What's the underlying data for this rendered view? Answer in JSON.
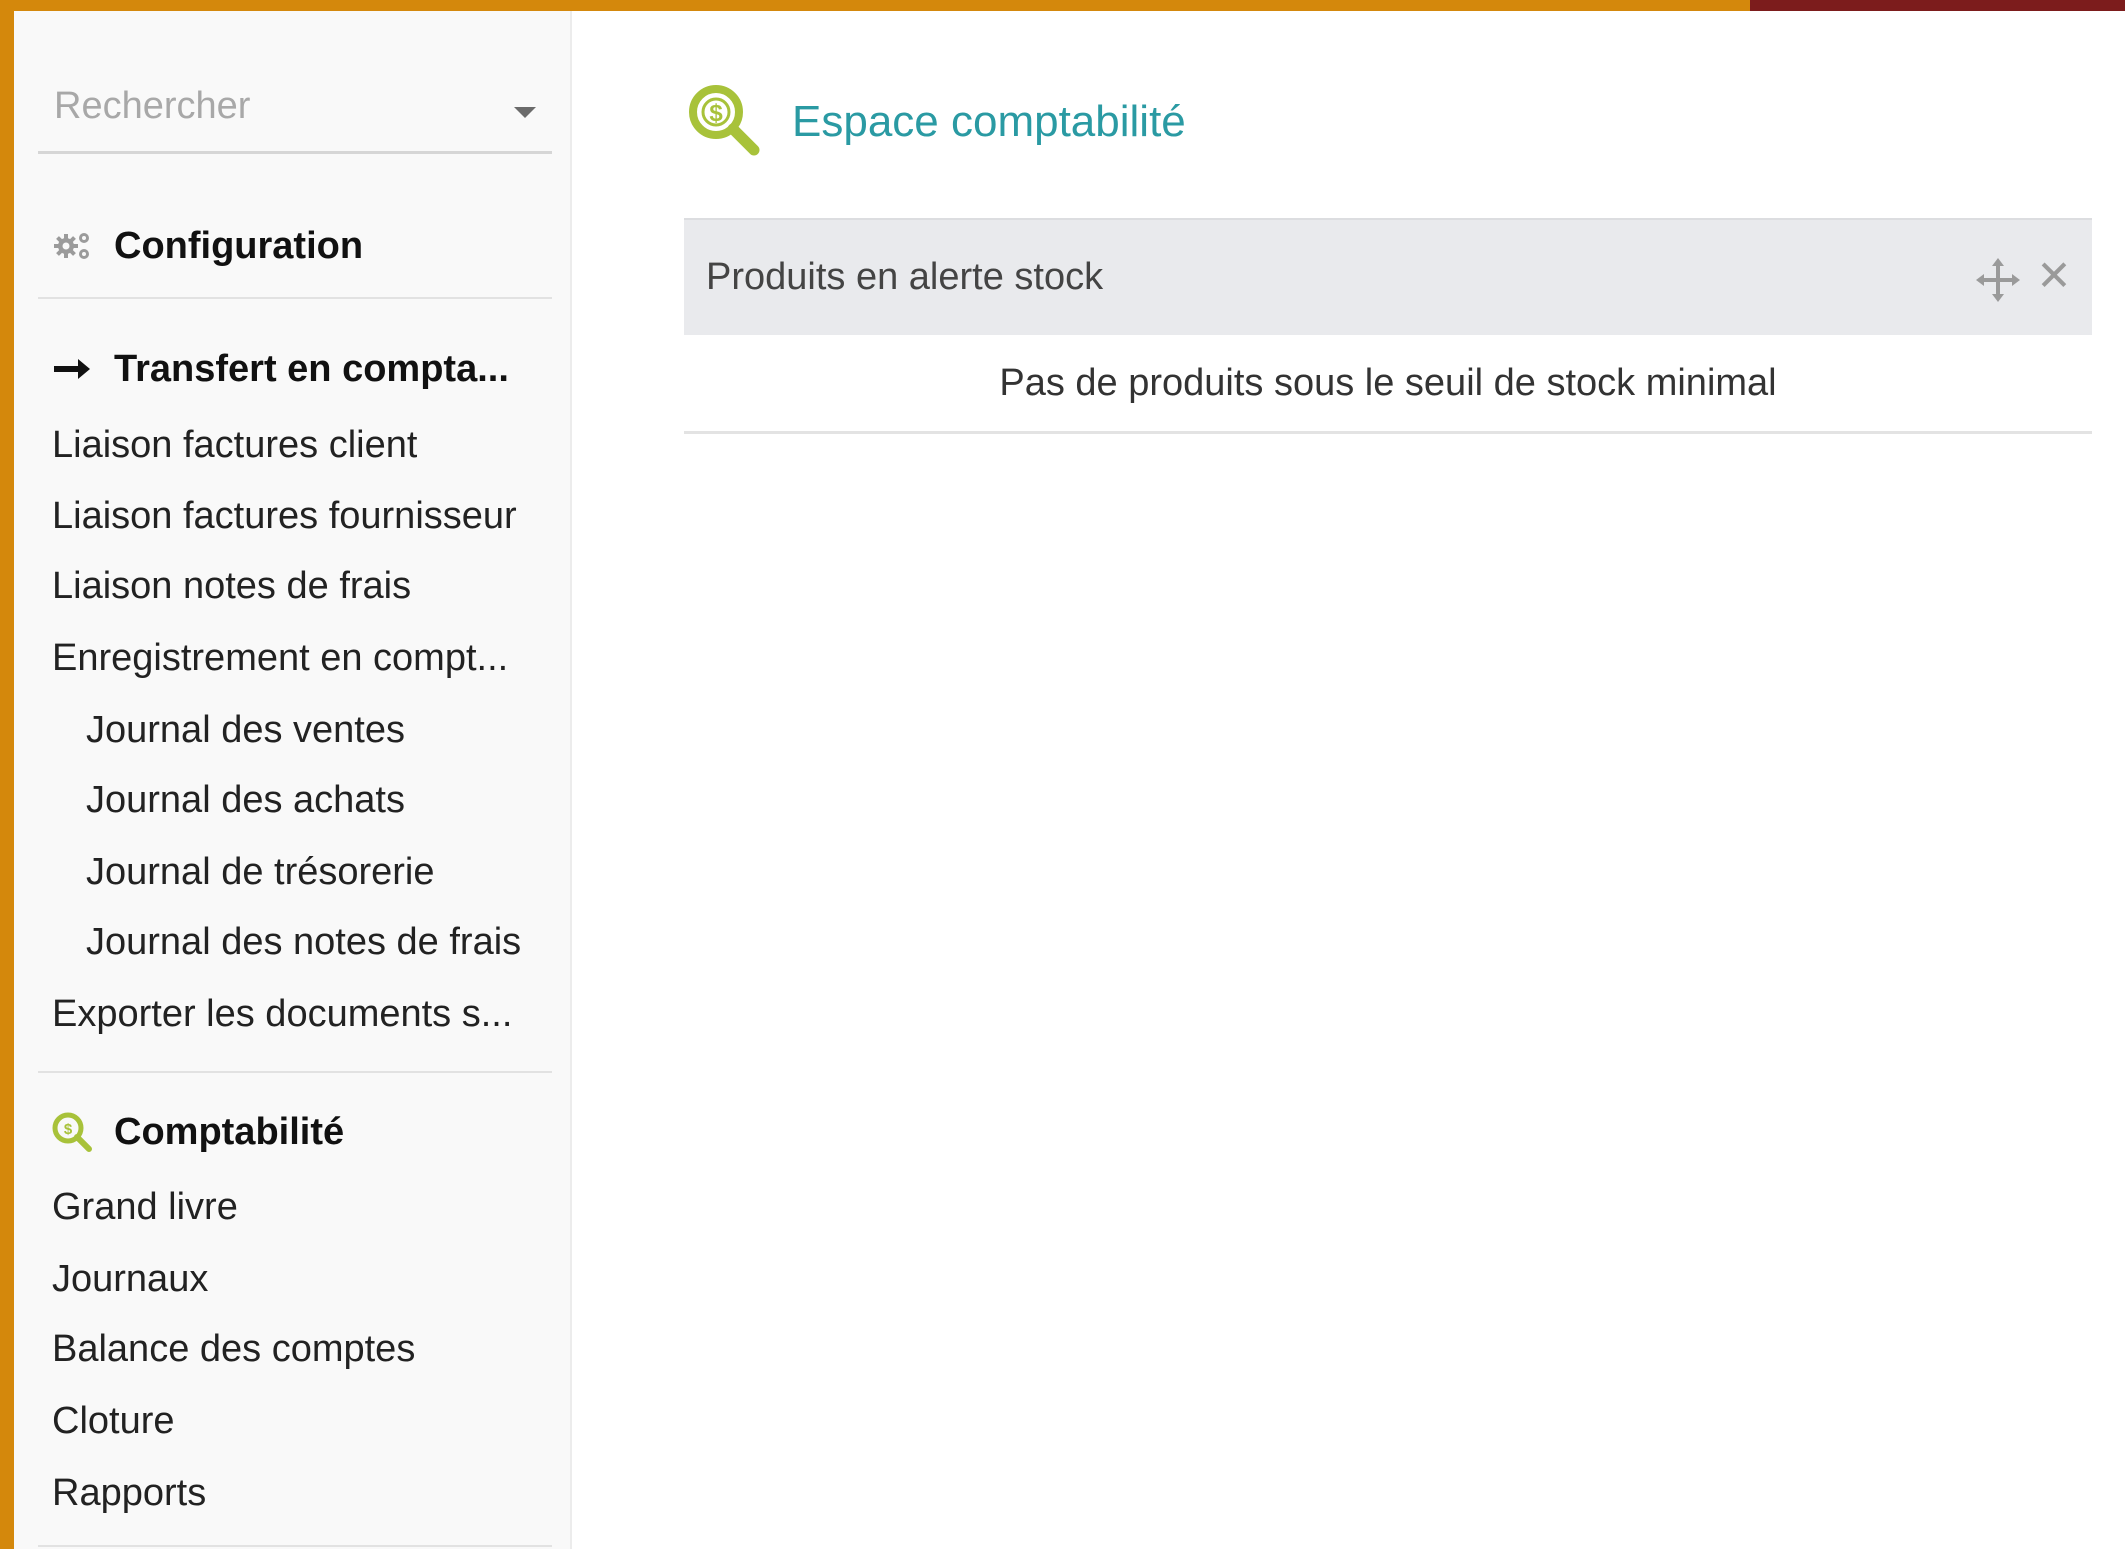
{
  "colors": {
    "frame_border": "#d4880c",
    "frame_top_right": "#7c1c1c",
    "accent_title": "#2a9aa3",
    "icon_green": "#a8c23a"
  },
  "sidebar": {
    "search": {
      "placeholder": "Rechercher"
    },
    "configuration": {
      "icon": "gears-icon",
      "label": "Configuration"
    },
    "transfer": {
      "icon": "arrow-right-icon",
      "label": "Transfert en compta...",
      "items": [
        {
          "label": "Liaison factures client"
        },
        {
          "label": "Liaison factures fournisseur"
        },
        {
          "label": "Liaison notes de frais"
        },
        {
          "label": "Enregistrement en compt..."
        }
      ],
      "subitems": [
        {
          "label": "Journal des ventes"
        },
        {
          "label": "Journal des achats"
        },
        {
          "label": "Journal de trésorerie"
        },
        {
          "label": "Journal des notes de frais"
        }
      ],
      "export_label": "Exporter les documents s..."
    },
    "accounting": {
      "icon": "accounting-search-icon",
      "label": "Comptabilité",
      "items": [
        {
          "label": "Grand livre"
        },
        {
          "label": "Journaux"
        },
        {
          "label": "Balance des comptes"
        },
        {
          "label": "Cloture"
        },
        {
          "label": "Rapports"
        }
      ]
    }
  },
  "main": {
    "title": "Espace comptabilité",
    "title_icon": "accounting-search-icon",
    "widget": {
      "title": "Produits en alerte stock",
      "move_icon": "move-icon",
      "close_icon": "close-icon",
      "close_glyph": "✕",
      "empty_message": "Pas de produits sous le seuil de stock minimal"
    }
  }
}
